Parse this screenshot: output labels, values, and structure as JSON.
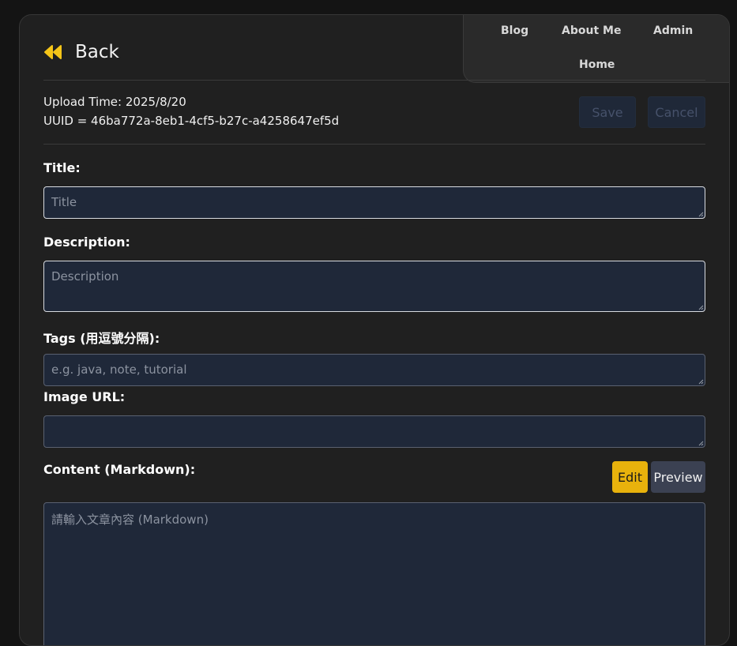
{
  "nav": {
    "blog": "Blog",
    "about": "About Me",
    "admin": "Admin",
    "home": "Home"
  },
  "back_label": "Back",
  "meta": {
    "upload_time": "Upload Time: 2025/8/20",
    "uuid": "UUID = 46ba772a-8eb1-4cf5-b27c-a4258647ef5d"
  },
  "actions": {
    "save": "Save",
    "cancel": "Cancel"
  },
  "form": {
    "title_label": "Title:",
    "title_placeholder": "Title",
    "title_value": "",
    "description_label": "Description:",
    "description_placeholder": "Description",
    "description_value": "",
    "tags_label": "Tags (用逗號分隔):",
    "tags_placeholder": "e.g. java, note, tutorial",
    "tags_value": "",
    "image_label": "Image URL:",
    "image_placeholder": "",
    "image_value": "",
    "content_label": "Content (Markdown):",
    "content_placeholder": "請輸入文章內容 (Markdown)",
    "content_value": ""
  },
  "editor_tabs": {
    "edit": "Edit",
    "preview": "Preview"
  },
  "colors": {
    "accent": "#e8b20c",
    "field_bg": "#1f2839",
    "card_bg": "#202020",
    "page_bg": "#141414"
  },
  "icons": {
    "back": "rewind-double-triangle-icon",
    "resize": "resize-grip-icon"
  }
}
